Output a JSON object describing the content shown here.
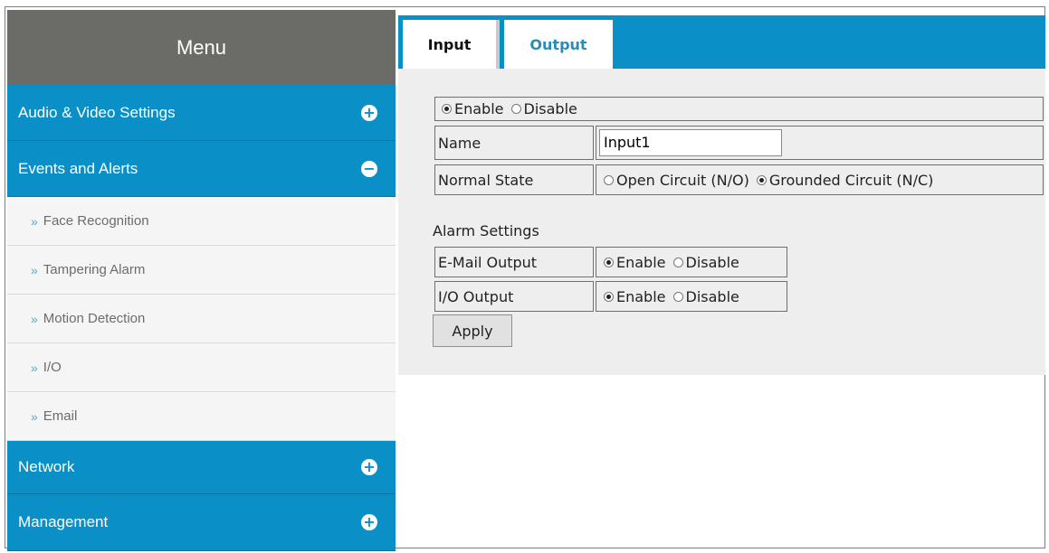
{
  "sidebar": {
    "menu_title": "Menu",
    "sections": [
      {
        "label": "Audio & Video Settings",
        "icon": "plus-circle-icon"
      },
      {
        "label": "Events and Alerts",
        "icon": "minus-circle-icon"
      },
      {
        "label": "Network",
        "icon": "plus-circle-icon"
      },
      {
        "label": "Management",
        "icon": "plus-circle-icon"
      }
    ],
    "subitems": [
      "Face Recognition",
      "Tampering Alarm",
      "Motion Detection",
      "I/O",
      "Email"
    ],
    "chevron": "»"
  },
  "tabs": [
    {
      "label": "Input",
      "active": true
    },
    {
      "label": "Output",
      "active": false
    }
  ],
  "form": {
    "enable_label": "Enable",
    "disable_label": "Disable",
    "enabled": true,
    "name_label": "Name",
    "name_value": "Input1",
    "normal_state_label": "Normal State",
    "open_circuit_label": "Open Circuit (N/O)",
    "grounded_circuit_label": "Grounded Circuit (N/C)",
    "normal_state_selected": "Grounded Circuit (N/C)",
    "alarm_settings_title": "Alarm Settings",
    "email_output_label": "E-Mail Output",
    "io_output_label": "I/O Output",
    "email_output_enabled": true,
    "io_output_enabled": true,
    "apply_label": "Apply"
  },
  "colors": {
    "accent_blue": "#0a8fc7",
    "menu_header_gray": "#6b6b68",
    "content_bg": "#eeeeee"
  }
}
